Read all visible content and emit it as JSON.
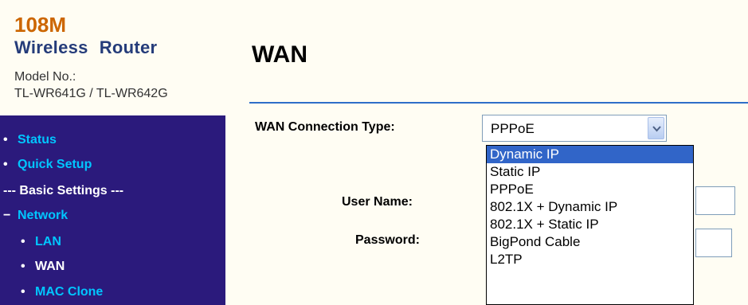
{
  "brand": {
    "model_line": "108M",
    "product_word1": "Wireless",
    "product_word2": "Router",
    "model_label": "Model No.:",
    "model_value": "TL-WR641G / TL-WR642G"
  },
  "menu": {
    "status": "Status",
    "quick_setup": "Quick Setup",
    "basic_settings": "--- Basic Settings ---",
    "network": "Network",
    "lan": "LAN",
    "wan": "WAN",
    "mac_clone": "MAC Clone"
  },
  "main": {
    "title": "WAN",
    "wan_type_label": "WAN Connection Type:",
    "wan_type_value": "PPPoE",
    "username_label": "User Name:",
    "password_label": "Password:"
  },
  "dropdown": {
    "options": [
      "Dynamic IP",
      "Static IP",
      "PPPoE",
      "802.1X + Dynamic IP",
      "802.1X + Static IP",
      "BigPond Cable",
      "L2TP"
    ],
    "highlighted": "Dynamic IP"
  },
  "colors": {
    "menu_background": "#2b1a7c",
    "menu_link": "#00c6ff",
    "brand_orange": "#cc6600",
    "brand_blue": "#253c7a",
    "highlight": "#3165c8"
  }
}
